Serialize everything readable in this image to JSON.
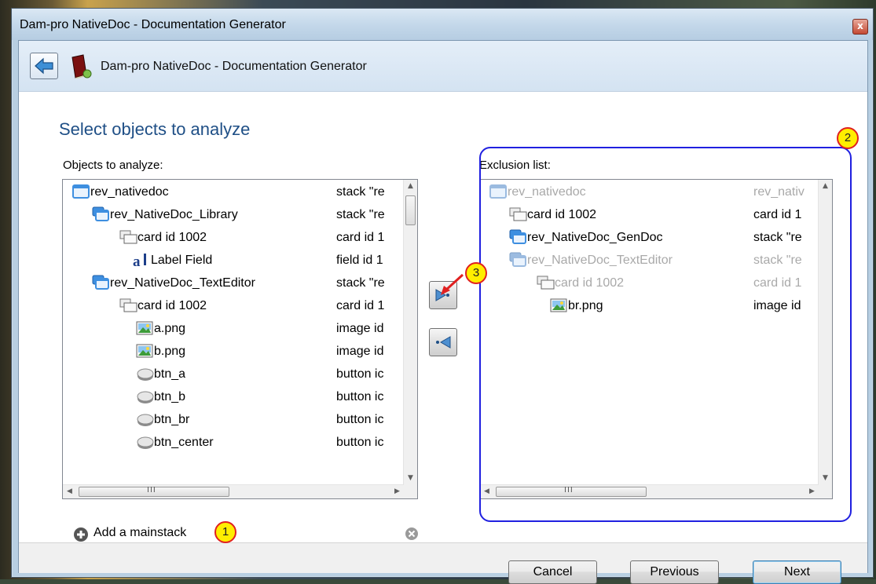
{
  "window": {
    "title": "Dam-pro NativeDoc - Documentation Generator",
    "close_glyph": "x"
  },
  "header": {
    "title": "Dam-pro NativeDoc - Documentation Generator"
  },
  "page": {
    "heading": "Select objects to analyze"
  },
  "left_panel": {
    "label": "Objects to analyze:",
    "items": [
      {
        "name": "rev_nativedoc",
        "desc": "stack \"re",
        "icon": "stack-icon"
      },
      {
        "name": "rev_NativeDoc_Library",
        "desc": "stack \"re",
        "icon": "substack-icon"
      },
      {
        "name": "card id 1002",
        "desc": "card id 1",
        "icon": "card-icon"
      },
      {
        "name": "Label Field",
        "desc": "field id 1",
        "icon": "field-icon"
      },
      {
        "name": "rev_NativeDoc_TextEditor",
        "desc": "stack \"re",
        "icon": "substack-icon"
      },
      {
        "name": "card id 1002",
        "desc": "card id 1",
        "icon": "card-icon"
      },
      {
        "name": "a.png",
        "desc": "image id",
        "icon": "image-icon"
      },
      {
        "name": "b.png",
        "desc": "image id",
        "icon": "image-icon"
      },
      {
        "name": "btn_a",
        "desc": "button ic",
        "icon": "button-icon"
      },
      {
        "name": "btn_b",
        "desc": "button ic",
        "icon": "button-icon"
      },
      {
        "name": "btn_br",
        "desc": "button ic",
        "icon": "button-icon"
      },
      {
        "name": "btn_center",
        "desc": "button ic",
        "icon": "button-icon"
      }
    ],
    "scroll_grip": "III"
  },
  "right_panel": {
    "label": "Exclusion list:",
    "items": [
      {
        "name": "rev_nativedoc",
        "desc": "rev_nativ",
        "icon": "stack-icon",
        "dimmed": true
      },
      {
        "name": "card id 1002",
        "desc": "card id 1",
        "icon": "card-icon",
        "dimmed": false
      },
      {
        "name": "rev_NativeDoc_GenDoc",
        "desc": "stack \"re",
        "icon": "substack-icon",
        "dimmed": false
      },
      {
        "name": "rev_NativeDoc_TextEditor",
        "desc": "stack \"re",
        "icon": "substack-icon",
        "dimmed": true
      },
      {
        "name": "card id 1002",
        "desc": "card id 1",
        "icon": "card-icon",
        "dimmed": true
      },
      {
        "name": "br.png",
        "desc": "image id",
        "icon": "image-icon",
        "dimmed": false
      }
    ],
    "scroll_grip": "III"
  },
  "movers": {
    "add_icon": "move-to-exclusion-icon",
    "remove_icon": "move-from-exclusion-icon"
  },
  "add_mainstack": {
    "label": "Add a mainstack"
  },
  "buttons": {
    "cancel": "Cancel",
    "previous": "Previous",
    "next": "Next"
  },
  "callouts": {
    "one": "1",
    "two": "2",
    "three": "3"
  },
  "colors": {
    "heading": "#1f4f86",
    "annotation_outline": "#2020e0",
    "callout_fill": "#ffee00",
    "callout_arrow": "#e02020"
  }
}
